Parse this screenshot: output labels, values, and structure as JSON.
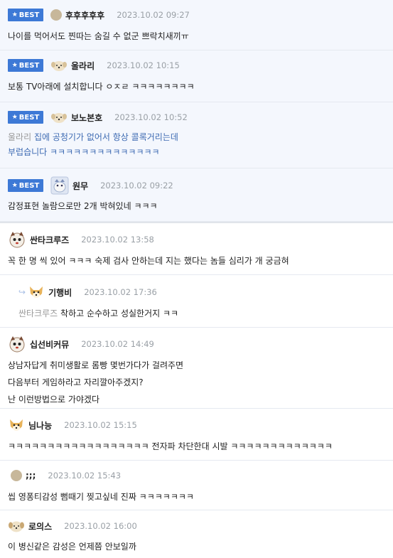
{
  "comments": [
    {
      "best": true,
      "badge": "BEST",
      "nick": "후후후후후",
      "date": "2023.10.02 09:27",
      "text": "나이를 먹어서도 찐따는 숨길 수 없군 쁘락치새끼ㅠ"
    },
    {
      "best": true,
      "badge": "BEST",
      "nick": "울라리",
      "date": "2023.10.02 10:15",
      "text": "보통 TV아래에 설치합니다 ㅇㅈㄹ ㅋㅋㅋㅋㅋㅋㅋㅋ"
    },
    {
      "best": true,
      "badge": "BEST",
      "nick": "보노본호",
      "date": "2023.10.02 10:52",
      "ref": "울라리",
      "line1": "집에 공청기가 없어서 항상 콜록거리는데",
      "line2": "부럽습니다 ㅋㅋㅋㅋㅋㅋㅋㅋㅋㅋㅋㅋㅋㅋ"
    },
    {
      "best": true,
      "badge": "BEST",
      "nick": "원무",
      "date": "2023.10.02 09:22",
      "text": "감정표현 놀람으로만 2개 박혀있네 ㅋㅋㅋ"
    },
    {
      "nick": "싼타크루즈",
      "date": "2023.10.02 13:58",
      "text": "꼭 한 명 씩 있어 ㅋㅋㅋ 숙제 검사 안하는데 지는 했다는 놈들 심리가 개 궁금혀"
    },
    {
      "reply": true,
      "nick": "기행비",
      "date": "2023.10.02 17:36",
      "ref": "싼타크루즈",
      "text": "착하고 순수하고 성실한거지 ㅋㅋ"
    },
    {
      "nick": "십선비커뮤",
      "date": "2023.10.02 14:49",
      "line1": "상남자답게 취미생활로 롬빵 몇번가다가 걸려주면",
      "line2": "다음부터 게임하라고 자리깔아주겠지?",
      "line3": "난 이런방법으로 가야겠다"
    },
    {
      "nick": "님나능",
      "date": "2023.10.02 15:15",
      "text": "ㅋㅋㅋㅋㅋㅋㅋㅋㅋㅋㅋㅋㅋㅋㅋㅋㅋㅋ 전자파 차단한대 시발 ㅋㅋㅋㅋㅋㅋㅋㅋㅋㅋㅋㅋㅋ"
    },
    {
      "nick": ";;;",
      "date": "2023.10.02 15:43",
      "text": "씹 영퐁티감성 뻠때기 찢고싶네 진짜 ㅋㅋㅋㅋㅋㅋㅋ"
    },
    {
      "nick": "로의스",
      "date": "2023.10.02 16:00",
      "text": "이 병신같은 감성은 언제쯤 안보일까"
    }
  ]
}
